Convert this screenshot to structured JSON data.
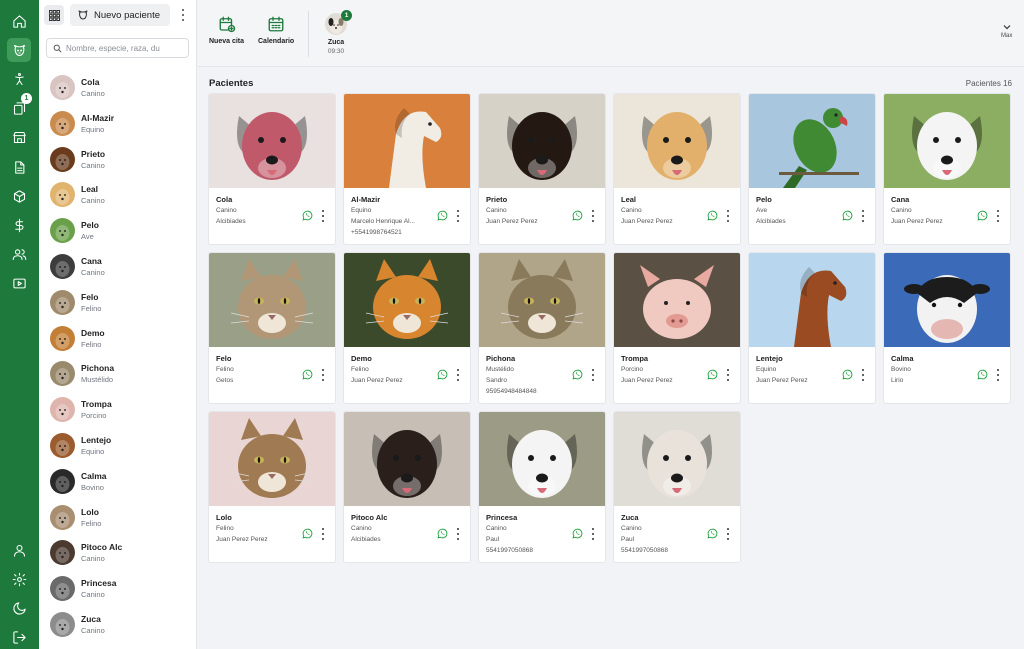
{
  "list": {
    "new_patient_label": "Nuevo paciente",
    "search_placeholder": "Nombre, especie, raza, du",
    "items": [
      {
        "name": "Cola",
        "species": "Canino",
        "color": "#d8c4c0"
      },
      {
        "name": "Al-Mazir",
        "species": "Equino",
        "color": "#c98b4e"
      },
      {
        "name": "Prieto",
        "species": "Canino",
        "color": "#6a3b1c"
      },
      {
        "name": "Leal",
        "species": "Canino",
        "color": "#e1b46e"
      },
      {
        "name": "Pelo",
        "species": "Ave",
        "color": "#6aa04a"
      },
      {
        "name": "Cana",
        "species": "Canino",
        "color": "#3d3d3d"
      },
      {
        "name": "Felo",
        "species": "Felino",
        "color": "#a08a6c"
      },
      {
        "name": "Demo",
        "species": "Felino",
        "color": "#c27f35"
      },
      {
        "name": "Pichona",
        "species": "Mustélido",
        "color": "#9a8a6c"
      },
      {
        "name": "Trompa",
        "species": "Porcino",
        "color": "#dfb4ad"
      },
      {
        "name": "Lentejo",
        "species": "Equino",
        "color": "#9a5b2e"
      },
      {
        "name": "Calma",
        "species": "Bovino",
        "color": "#2a2a2a"
      },
      {
        "name": "Lolo",
        "species": "Felino",
        "color": "#a98e70"
      },
      {
        "name": "Pitoco Alc",
        "species": "Canino",
        "color": "#4a3a30"
      },
      {
        "name": "Princesa",
        "species": "Canino",
        "color": "#6a6a6a"
      },
      {
        "name": "Zuca",
        "species": "Canino",
        "color": "#8c8c8c"
      }
    ]
  },
  "rail": {
    "icons": [
      "home-icon",
      "pet-icon",
      "accessibility-icon",
      "copy-icon",
      "store-icon",
      "document-icon",
      "box-icon",
      "dollar-icon",
      "users-icon",
      "video-icon",
      "user-icon",
      "settings-icon",
      "moon-icon",
      "logout-icon"
    ],
    "badge_count": "1"
  },
  "topbar": {
    "new_appointment": "Nueva cita",
    "calendar": "Calendario",
    "waiting_name": "Zuca",
    "waiting_time": "09:30",
    "waiting_badge": "1",
    "user": "Max"
  },
  "main": {
    "title": "Pacientes",
    "count": "Pacientes 16",
    "cards": [
      {
        "name": "Cola",
        "l1": "Canino",
        "l2": "Alcibiades",
        "l3": "",
        "bg": "#e9e0e0",
        "fg": "#c05a6b",
        "kind": "dog"
      },
      {
        "name": "Al-Mazir",
        "l1": "Equino",
        "l2": "Marcelo Henrique Al...",
        "l3": "+5541998764521",
        "bg": "#d9813c",
        "fg": "#f1ece4",
        "kind": "horse"
      },
      {
        "name": "Prieto",
        "l1": "Canino",
        "l2": "Juan Perez Perez",
        "l3": "",
        "bg": "#d6d2c8",
        "fg": "#241812",
        "kind": "dog"
      },
      {
        "name": "Leal",
        "l1": "Canino",
        "l2": "Juan Perez Perez",
        "l3": "",
        "bg": "#ece6da",
        "fg": "#e2b06a",
        "kind": "dog"
      },
      {
        "name": "Pelo",
        "l1": "Ave",
        "l2": "Alcibiades",
        "l3": "",
        "bg": "#a8c6de",
        "fg": "#3f8a32",
        "kind": "bird"
      },
      {
        "name": "Cana",
        "l1": "Canino",
        "l2": "Juan Perez Perez",
        "l3": "",
        "bg": "#8cae62",
        "fg": "#f4f4f4",
        "kind": "dog"
      },
      {
        "name": "Felo",
        "l1": "Felino",
        "l2": "Getos",
        "l3": "",
        "bg": "#9aa088",
        "fg": "#b19776",
        "kind": "cat"
      },
      {
        "name": "Demo",
        "l1": "Felino",
        "l2": "Juan Perez Perez",
        "l3": "",
        "bg": "#3a4a2a",
        "fg": "#d7852e",
        "kind": "cat"
      },
      {
        "name": "Pichona",
        "l1": "Mustélido",
        "l2": "Sandro",
        "l3": "95954948484848",
        "bg": "#b0a489",
        "fg": "#8a7a5c",
        "kind": "cat"
      },
      {
        "name": "Trompa",
        "l1": "Porcino",
        "l2": "Juan Perez Perez",
        "l3": "",
        "bg": "#5a5044",
        "fg": "#f0c9c1",
        "kind": "pig"
      },
      {
        "name": "Lentejo",
        "l1": "Equino",
        "l2": "Juan Perez Perez",
        "l3": "",
        "bg": "#b8d6ee",
        "fg": "#9a4b22",
        "kind": "horse"
      },
      {
        "name": "Calma",
        "l1": "Bovino",
        "l2": "Lirio",
        "l3": "",
        "bg": "#3a6ab8",
        "fg": "#1c1c1c",
        "kind": "cow"
      },
      {
        "name": "Lolo",
        "l1": "Felino",
        "l2": "Juan Perez Perez",
        "l3": "",
        "bg": "#e9d5d3",
        "fg": "#a07a52",
        "kind": "cat"
      },
      {
        "name": "Pitoco Alc",
        "l1": "Canino",
        "l2": "Alcibiades",
        "l3": "",
        "bg": "#c7bfb6",
        "fg": "#2a1f1a",
        "kind": "dog"
      },
      {
        "name": "Princesa",
        "l1": "Canino",
        "l2": "Paul",
        "l3": "5541997050868",
        "bg": "#9b9b86",
        "fg": "#f4f4f4",
        "kind": "dog"
      },
      {
        "name": "Zuca",
        "l1": "Canino",
        "l2": "Paul",
        "l3": "5541997050868",
        "bg": "#e0ddd6",
        "fg": "#e8e2da",
        "kind": "dog"
      }
    ]
  }
}
